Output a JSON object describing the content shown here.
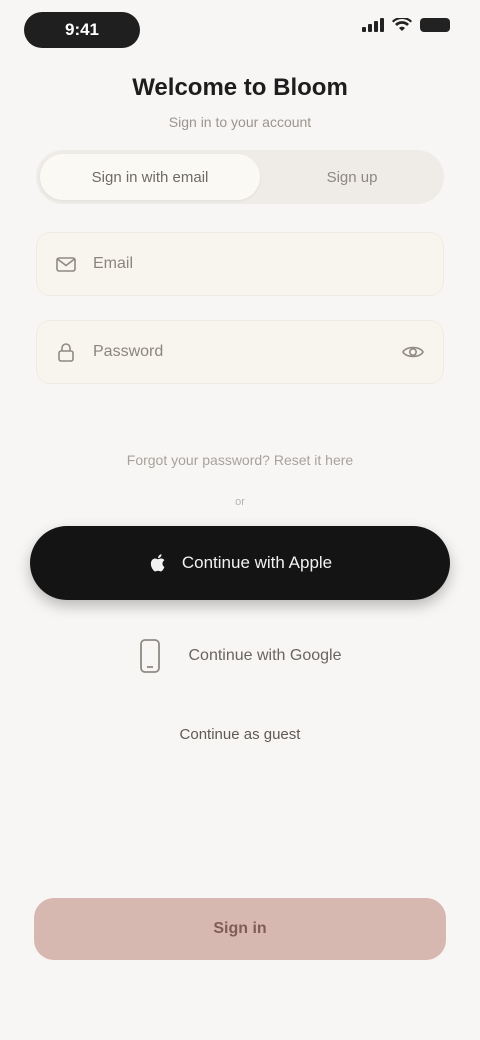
{
  "status_bar": {
    "time": "9:41"
  },
  "header": {
    "title": "Welcome to Bloom",
    "subtitle": "Sign in to your account"
  },
  "tabs": [
    {
      "label": "Sign in with email"
    },
    {
      "label": "Sign up"
    }
  ],
  "form": {
    "email_placeholder": "Email",
    "password_placeholder": "Password"
  },
  "links": {
    "forgot": "Forgot your password? Reset it here",
    "divider": "or",
    "guest": "Continue as guest"
  },
  "buttons": {
    "apple": "Continue with Apple",
    "google": "Continue with Google",
    "continue": "Sign in"
  },
  "colors": {
    "background": "#f8f6f4",
    "primary_dark": "#141414",
    "accent": "#d6b8b1"
  }
}
